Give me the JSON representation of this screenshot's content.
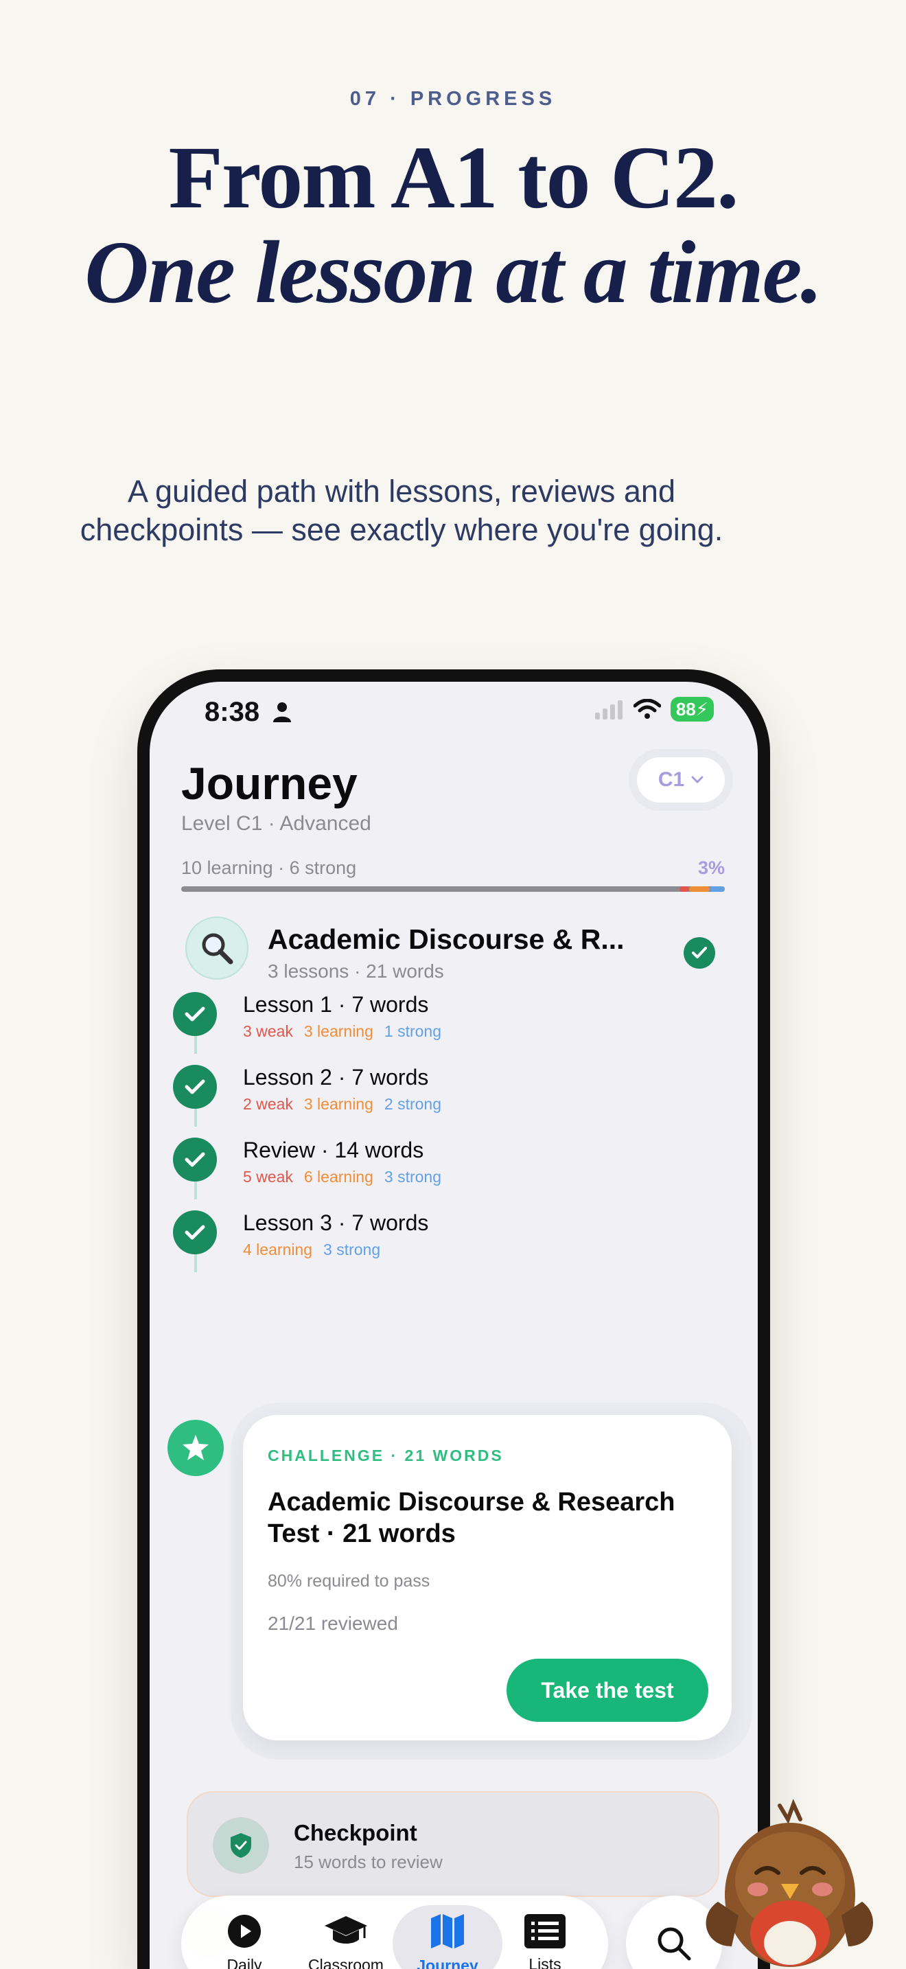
{
  "marketing": {
    "eyebrow": "07 · PROGRESS",
    "headline_line1": "From A1 to C2.",
    "headline_line2": "One lesson at a time.",
    "subhead": "A guided path with lessons, reviews and checkpoints — see exactly where you're going."
  },
  "status_bar": {
    "time": "8:38",
    "battery": "88"
  },
  "header": {
    "title": "Journey",
    "subtitle": "Level C1 · Advanced",
    "level_selector": "C1"
  },
  "progress": {
    "summary": "10 learning · 6 strong",
    "percent_label": "3%",
    "percent": 3
  },
  "unit": {
    "icon": "magnifier-icon",
    "title": "Academic Discourse & R...",
    "subtitle": "3 lessons · 21 words"
  },
  "lessons": [
    {
      "title": "Lesson 1 · 7 words",
      "weak": "3 weak",
      "learning": "3 learning",
      "strong": "1 strong"
    },
    {
      "title": "Lesson 2 · 7 words",
      "weak": "2 weak",
      "learning": "3 learning",
      "strong": "2 strong"
    },
    {
      "title": "Review · 14 words",
      "weak": "5 weak",
      "learning": "6 learning",
      "strong": "3 strong"
    },
    {
      "title": "Lesson 3 · 7 words",
      "weak": "",
      "learning": "4 learning",
      "strong": "3 strong"
    }
  ],
  "challenge": {
    "eyebrow": "CHALLENGE · 21 WORDS",
    "title": "Academic Discourse & Research Test · 21 words",
    "requirement": "80% required to pass",
    "reviewed": "21/21 reviewed",
    "button": "Take the test"
  },
  "checkpoint": {
    "title": "Checkpoint",
    "subtitle": "15 words to review"
  },
  "tabs": [
    {
      "label": "Daily",
      "icon": "play-icon"
    },
    {
      "label": "Classroom",
      "icon": "graduation-cap-icon"
    },
    {
      "label": "Journey",
      "icon": "map-icon"
    },
    {
      "label": "Lists",
      "icon": "list-icon"
    }
  ],
  "colors": {
    "accent_green": "#19b67a",
    "weak": "#e2574c",
    "learning": "#ef8d38",
    "strong": "#62a0e6",
    "active_tab": "#1b73e8"
  }
}
